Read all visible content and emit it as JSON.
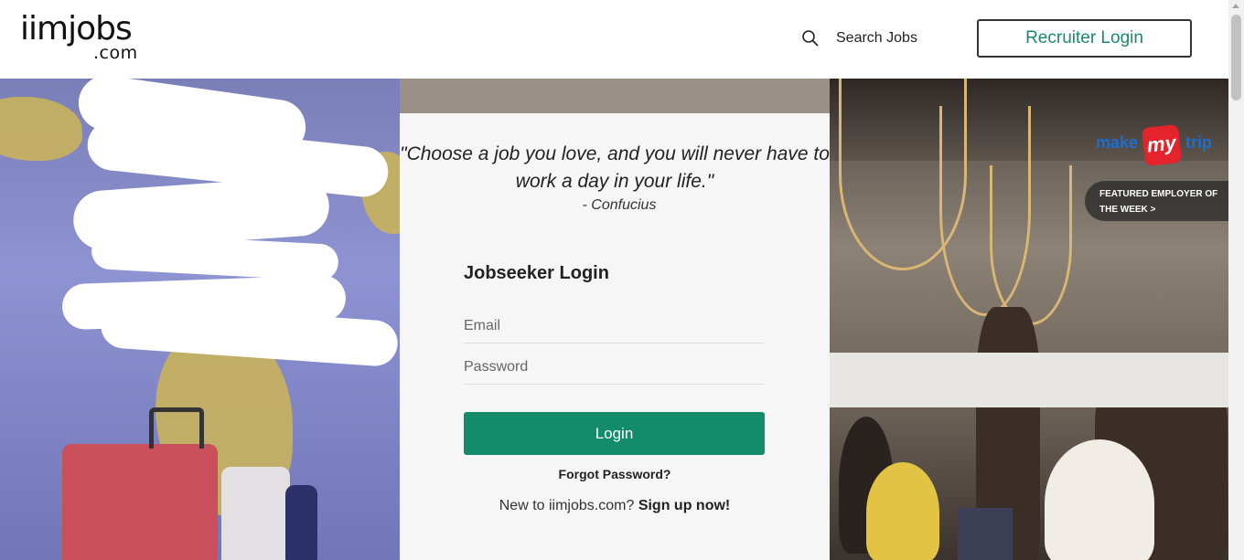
{
  "header": {
    "logo_main": "iimjobs",
    "logo_sub": ".com",
    "search_label": "Search Jobs",
    "recruiter_login": "Recruiter Login"
  },
  "hero": {
    "quote": "\"Choose a job you love, and you will never have to work a day in your life.\"",
    "quote_author": "- Confucius",
    "featured_brand": {
      "make": "make",
      "my": "my",
      "trip": "trip"
    },
    "featured_label": "FEATURED EMPLOYER OF THE WEEK >"
  },
  "login": {
    "title": "Jobseeker Login",
    "email_placeholder": "Email",
    "password_placeholder": "Password",
    "button": "Login",
    "forgot": "Forgot Password?",
    "new_user_text": "New to iimjobs.com?",
    "signup": "Sign up now!"
  },
  "colors": {
    "accent": "#138c6c",
    "recruiter_text": "#1a8a6c",
    "mmt_red": "#e4232c",
    "mmt_blue": "#1a6fd1"
  }
}
